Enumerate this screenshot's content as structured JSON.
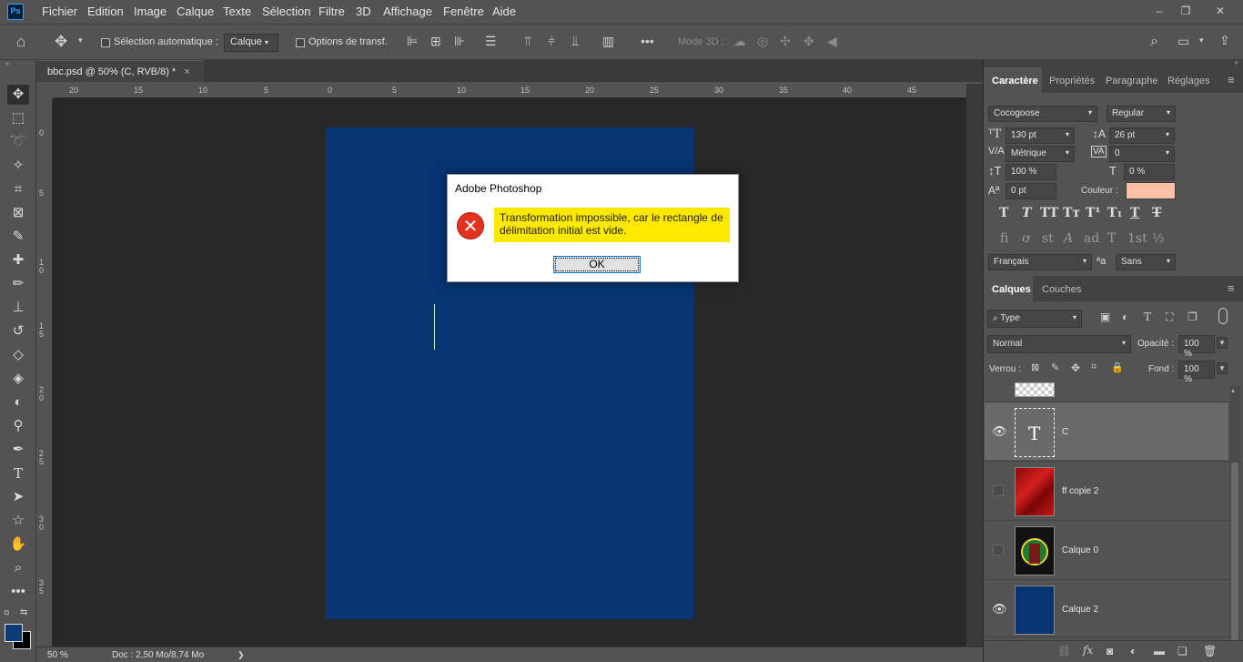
{
  "app": {
    "logo": "Ps"
  },
  "menu": [
    "Fichier",
    "Edition",
    "Image",
    "Calque",
    "Texte",
    "Sélection",
    "Filtre",
    "3D",
    "Affichage",
    "Fenêtre",
    "Aide"
  ],
  "window_controls": {
    "minimize": "–",
    "restore": "❐",
    "close": "✕"
  },
  "options_bar": {
    "auto_select_label": "Sélection automatique :",
    "auto_select_value": "Calque",
    "transform_label": "Options de transf.",
    "more": "•••",
    "mode3d_label": "Mode 3D :"
  },
  "document": {
    "tab_title": "bbc.psd @ 50% (C, RVB/8) *",
    "tab_close": "×",
    "ruler_top": [
      "20",
      "15",
      "10",
      "5",
      "0",
      "5",
      "10",
      "15",
      "20",
      "25",
      "30",
      "35",
      "40",
      "45"
    ],
    "ruler_left": [
      "0",
      "5",
      "1\n0",
      "1\n5",
      "2\n0",
      "2\n5",
      "3\n0",
      "3\n5"
    ],
    "zoom": "50 %",
    "doc_info": "Doc : 2,50 Mo/8,74 Mo",
    "status_arrow": "❯"
  },
  "dialog": {
    "title": "Adobe Photoshop",
    "icon": "✕",
    "message": "Transformation impossible, car le rectangle de délimitation initial est vide.",
    "ok_label": "OK"
  },
  "character_panel": {
    "tabs": [
      "Caractère",
      "Propriétés",
      "Paragraphe",
      "Réglages"
    ],
    "menu_icon": "≡",
    "font_family": "Cocogoose",
    "font_style": "Regular",
    "font_size": "130 pt",
    "leading": "26 pt",
    "kerning": "Métrique",
    "tracking": "0",
    "vertical_scale": "100 %",
    "horizontal_scale": "0 %",
    "baseline_shift": "0 pt",
    "color_label": "Couleur :",
    "color_value": "#fbc1a6",
    "style_buttons": [
      "T",
      "T",
      "TT",
      "Tт",
      "T¹",
      "T₁",
      "T",
      "T"
    ],
    "opentype_buttons": [
      "ﬁ",
      "ơ",
      "st",
      "A",
      "ad",
      "T",
      "1st",
      "½"
    ],
    "language": "Français",
    "aa_label": "ªa",
    "antialias": "Sans"
  },
  "layers_panel": {
    "tabs": [
      "Calques",
      "Couches"
    ],
    "menu_icon": "≡",
    "filter_type": "Type",
    "blend_mode": "Normal",
    "opacity_label": "Opacité :",
    "opacity_value": "100 %",
    "lock_label": "Verrou :",
    "fill_label": "Fond :",
    "fill_value": "100 %",
    "layers": [
      {
        "name": "C",
        "visible": true,
        "selected": true,
        "kind": "text",
        "thumb_glyph": "T"
      },
      {
        "name": "ff copie 2",
        "visible": false,
        "selected": false,
        "kind": "red"
      },
      {
        "name": "Calque 0",
        "visible": false,
        "selected": false,
        "kind": "poster"
      },
      {
        "name": "Calque 2",
        "visible": true,
        "selected": false,
        "kind": "blue"
      }
    ],
    "eye_icon": "👁",
    "bottom_icons": [
      "⛓",
      "fx",
      "◙",
      "◐",
      "▬",
      "❏",
      "🗑"
    ]
  },
  "colors": {
    "foreground": "#0c3a73",
    "background": "#000000",
    "artboard": "#063572",
    "highlight": "#fde900"
  }
}
